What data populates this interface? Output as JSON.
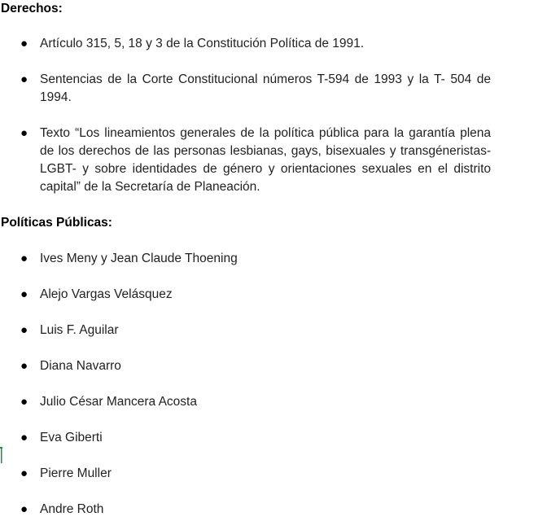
{
  "sections": {
    "derechos": {
      "heading": "Derechos:",
      "items": [
        "Artículo 315, 5, 18 y 3 de la Constitución Política de 1991.",
        "Sentencias de la Corte Constitucional números T-594 de 1993 y la T- 504 de 1994.",
        "Texto “Los lineamientos generales de la política pública para la garantía plena de los derechos de las personas lesbianas, gays, bisexuales y transgéneristas- LGBT- y sobre identidades de género y orientaciones sexuales en el distrito capital”  de la Secretaría de Planeación."
      ]
    },
    "politicas": {
      "heading": "Políticas Públicas:",
      "items": [
        "Ives Meny y Jean Claude Thoening",
        "Alejo Vargas Velásquez",
        "Luis F. Aguilar",
        "Diana Navarro",
        "Julio César Mancera Acosta",
        "Eva Giberti",
        "Pierre Muller",
        "Andre Roth"
      ]
    }
  },
  "bullet_symbol": "●",
  "colors": {
    "text": "#222222",
    "heading": "#000000",
    "cursor": "#1e8e3e"
  }
}
